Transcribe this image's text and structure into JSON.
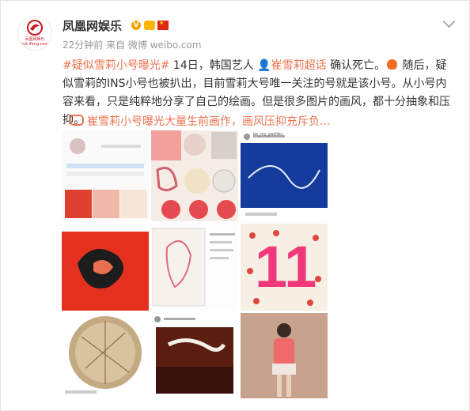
{
  "post": {
    "author": "凤凰网娱乐",
    "avatar_text": "凤凰网娱乐 ent.ifeng.com",
    "meta": "22分钟前 来自 微博 weibo.com",
    "hashtag": "#疑似雪莉小号曝光#",
    "text_1": " 14日，韩国艺人 ",
    "person_link": "崔雪莉超话",
    "text_2": " 确认死亡。",
    "text_3": " 随后，疑似雪莉的INS小号也被扒出，目前雪莉大号唯一关注的号就是该小号。从小号内容来看，只是纯粹地分享了自己的绘画。但是很多图片的画风，都十分抽象和压抑。",
    "article_link": "崔雪莉小号曝光大量生前画作，画风压抑充斥负..."
  },
  "images": {
    "count": 9,
    "thumb_account": "be_my_pashbs",
    "thumb_11": "11"
  },
  "colors": {
    "link": "#eb7350",
    "verified": "#f6a100"
  },
  "icons": {
    "verified": "verified-v-icon",
    "flag": "china-flag-icon",
    "expand": "chevron-down-icon",
    "link": "link-icon"
  }
}
